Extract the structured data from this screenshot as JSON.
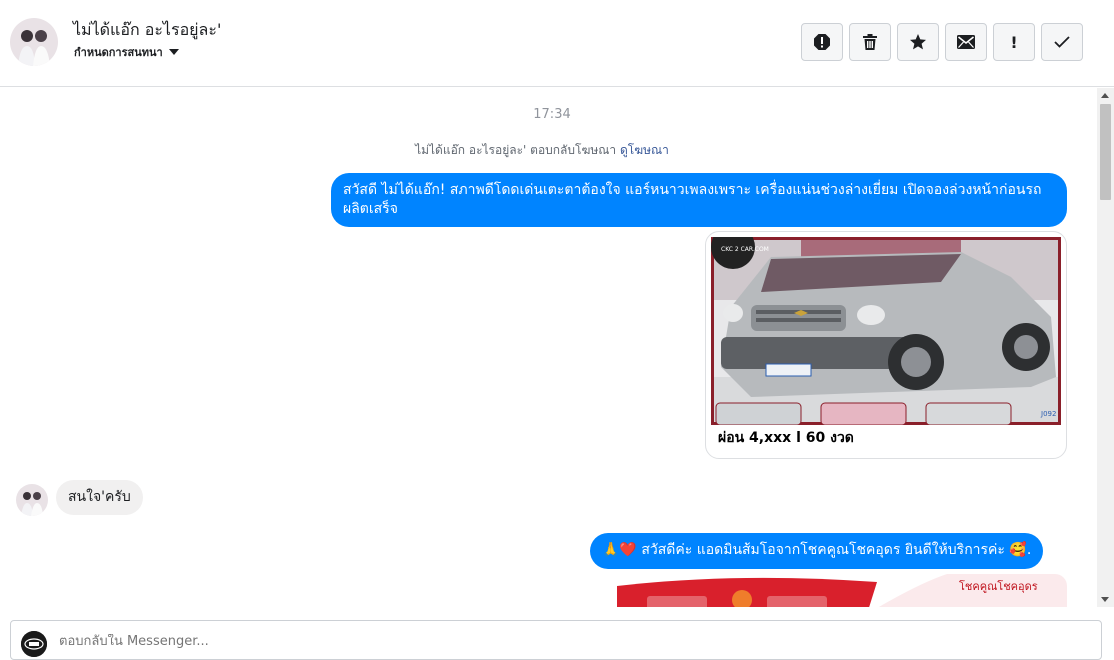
{
  "header": {
    "title": "ไม่ได้แอ๊ก อะไรอยู่ละ'",
    "subtitle": "กำหนดการสนทนา",
    "toolbar": [
      {
        "name": "report-icon"
      },
      {
        "name": "trash-icon"
      },
      {
        "name": "star-icon"
      },
      {
        "name": "envelope-icon"
      },
      {
        "name": "exclamation-icon",
        "label": "!"
      },
      {
        "name": "checkmark-icon"
      }
    ]
  },
  "thread": {
    "timestamp": "17:34",
    "ad_note": "ไม่ได้แอ๊ก อะไรอยู่ละ' ตอบกลับโฆษณา",
    "ad_link": "ดูโฆษณา",
    "messages": [
      {
        "from": "page",
        "text": "สวัสดี ไม่ได้แอ๊ก! สภาพดีโดดเด่นเตะตาต้องใจ แอร์หนาวเพลงเพราะ เครื่องแน่นช่วงล่างเยี่ยม เปิดจองล่วงหน้าก่อนรถผลิตเสร็จ"
      },
      {
        "from": "page",
        "type": "card",
        "card_title": "ผ่อน 4,xxx l 60 งวด",
        "watermark": "CKC 2 CAR.COM",
        "plate": "J092"
      },
      {
        "from": "user",
        "text": "สนใจ'ครับ"
      },
      {
        "from": "page",
        "text": "🙏❤️ สวัสดีค่ะ แอดมินส้มโอจากโชคคูณโชคอุดร ยินดีให้บริการค่ะ 🥰."
      },
      {
        "from": "page",
        "type": "image",
        "brand": "โชคคูณโชคอุดร"
      }
    ]
  },
  "reply": {
    "placeholder": "ตอบกลับใน Messenger..."
  },
  "colors": {
    "accent": "#0084ff",
    "link": "#385898",
    "incoming": "#f1f0f0"
  }
}
